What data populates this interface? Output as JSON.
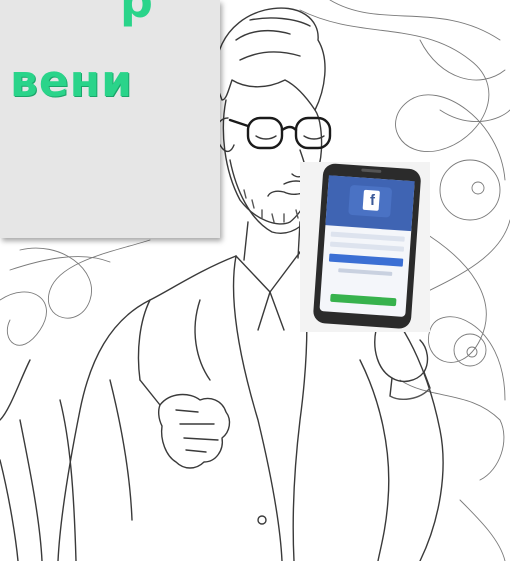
{
  "banner": {
    "text": "вени",
    "top_fragment": "р",
    "text_color": "#2ad48a",
    "background": "#e6e6e6"
  },
  "phone": {
    "app_icon": "facebook-f-icon",
    "brand_color": "#3b5998"
  },
  "illustration": {
    "subject": "man-with-glasses-and-beard-holding-phone",
    "style": "line-drawing"
  }
}
